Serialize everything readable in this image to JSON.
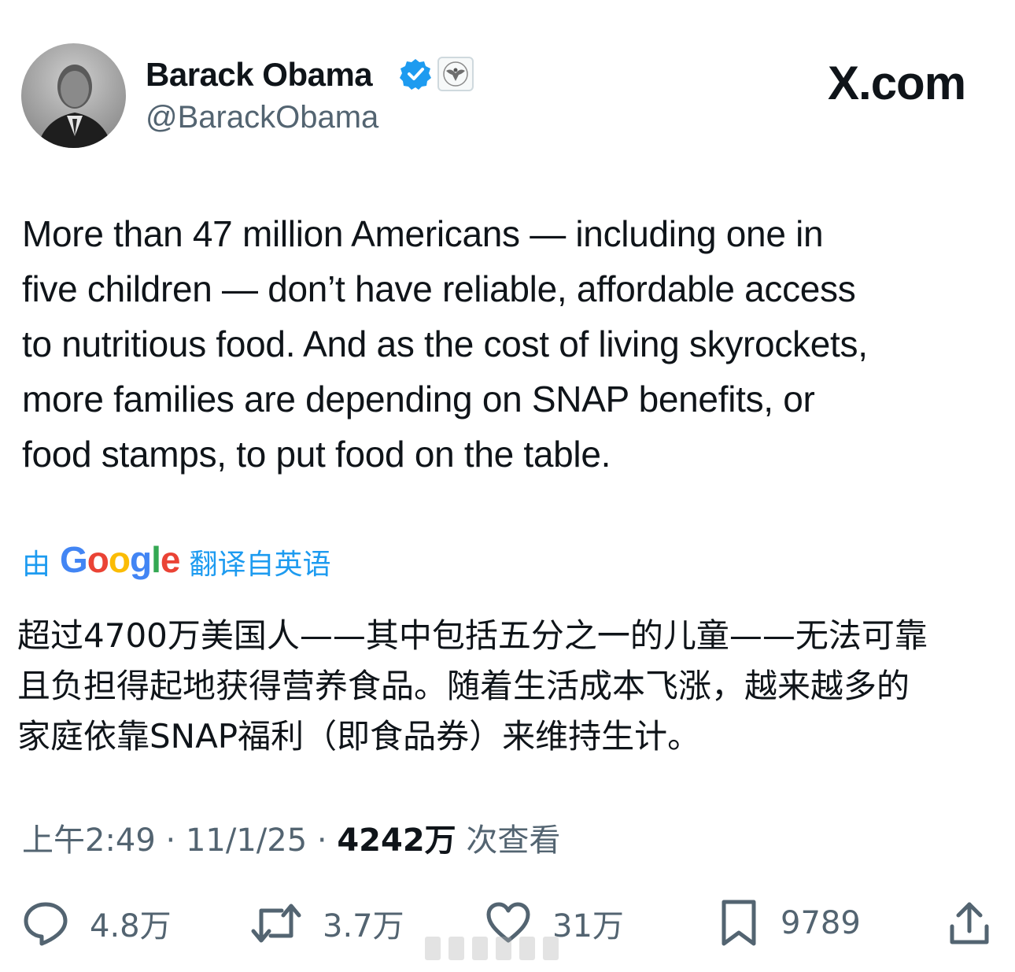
{
  "author": {
    "name": "Barack Obama",
    "handle": "@BarackObama",
    "avatar_icon": "profile-photo",
    "verified_icon": "verified-badge-icon",
    "affiliation_icon": "us-government-seal-icon"
  },
  "brand": {
    "label": "X.com"
  },
  "tweet": {
    "text": "More than 47 million Americans — including one in\nfive children — don’t have reliable, affordable access\nto nutritious food. And as the cost of living skyrockets,\nmore families are depending on SNAP benefits, or\nfood stamps, to put food on the table."
  },
  "translation": {
    "by_label": "由",
    "provider": "Google",
    "translated_label": "翻译自英语",
    "text": "超过4700万美国人——其中包括五分之一的儿童——无法可靠\n且负担得起地获得营养食品。随着生活成本飞涨，越来越多的\n家庭依靠SNAP福利（即食品券）来维持生计。"
  },
  "meta": {
    "time": "上午2:49",
    "separator": " · ",
    "date": "11/1/25",
    "views_count": "4242万",
    "views_label": " 次查看"
  },
  "actions": {
    "reply_count": "4.8万",
    "repost_count": "3.7万",
    "like_count": "31万",
    "bookmark_count": "9789"
  },
  "colors": {
    "text": "#0f1419",
    "secondary": "#536471",
    "accent": "#1d9bf0"
  }
}
